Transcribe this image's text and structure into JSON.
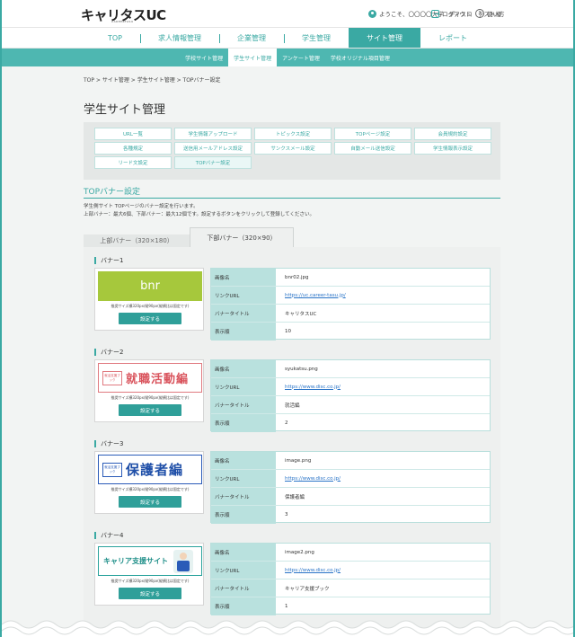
{
  "header": {
    "logo": "キャリタスUC",
    "logo_sub": "CAREERTASU",
    "welcome": "ようこそ、〇〇〇〇大学　ディスコ　テスト様",
    "logout": "ログアウト",
    "help": "使い方"
  },
  "main_nav": [
    "TOP",
    "求人情報管理",
    "企業管理",
    "学生管理",
    "サイト管理",
    "レポート"
  ],
  "sub_nav": [
    "学校サイト管理",
    "学生サイト管理",
    "アンケート管理",
    "学校オリジナル項目管理"
  ],
  "breadcrumb": "TOP > サイト管理 > 学生サイト管理 > TOPバナー設定",
  "page_title": "学生サイト管理",
  "grid_buttons": [
    [
      "URL一覧",
      "学生情報アップロード",
      "トピックス設定",
      "TOPページ設定",
      "会員規約設定"
    ],
    [
      "各種規定",
      "送信用メールアドレス設定",
      "サンクスメール設定",
      "自動メール送信設定",
      "学生情報表示設定"
    ],
    [
      "リード文設定",
      "TOPバナー設定"
    ]
  ],
  "section": {
    "title": "TOPバナー設定",
    "desc1": "学生側サイト TOPページのバナー設定を行います。",
    "desc2": "上部バナー：最大6個、下部バナー：最大12個です。設定するボタンをクリックして登録してください。"
  },
  "tabs": {
    "top": "上部バナー（320×180）",
    "bottom": "下部バナー（320×90）"
  },
  "labels": {
    "image_name": "画像名",
    "link_url": "リンクURL",
    "banner_title": "バナータイトル",
    "display_order": "表示順",
    "size_note": "推奨サイズ横320px/縦90px(縦横比は固定です)",
    "set_button": "設定する"
  },
  "banners": [
    {
      "label": "バナー1",
      "thumb_text": "bnr",
      "image": "bnr02.jpg",
      "url": "https://uc.career-tasu.jp/",
      "title": "キャリタスUC",
      "order": "10"
    },
    {
      "label": "バナー2",
      "thumb_badge": "就活支援ブック",
      "thumb_text": "就職活動編",
      "image": "syukatsu.png",
      "url": "https://www.disc.co.jp/",
      "title": "就活編",
      "order": "2"
    },
    {
      "label": "バナー3",
      "thumb_badge": "就活支援ブック",
      "thumb_text": "保護者編",
      "image": "image.png",
      "url": "https://www.disc.co.jp/",
      "title": "保護者編",
      "order": "3"
    },
    {
      "label": "バナー4",
      "thumb_text": "キャリア支援サイト",
      "image": "image2.png",
      "url": "https://www.disc.co.jp/",
      "title": "キャリア支援ブック",
      "order": "1"
    }
  ],
  "colors": {
    "accent": "#3aa9a3",
    "sub_nav": "#4eb7b1",
    "button": "#2f9f99",
    "info_key": "#b9e1de",
    "link": "#2a74c7"
  }
}
